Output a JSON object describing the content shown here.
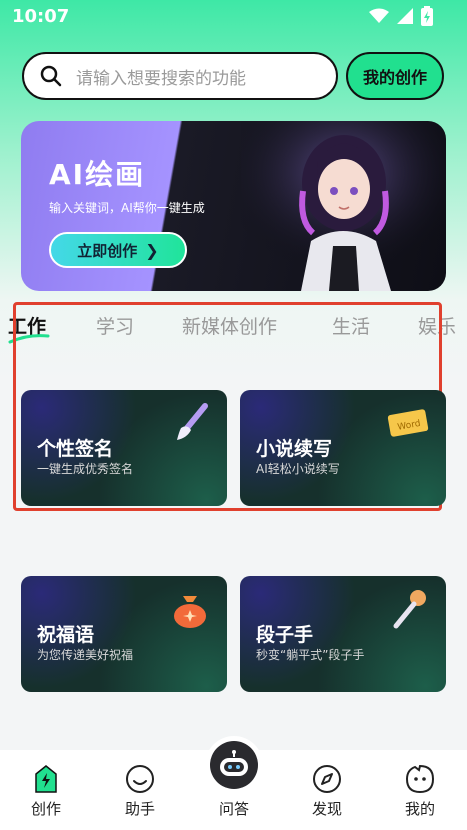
{
  "status": {
    "time": "10:07"
  },
  "search": {
    "placeholder": "请输入想要搜索的功能"
  },
  "header": {
    "my_create": "我的创作"
  },
  "banner": {
    "title": "AI绘画",
    "subtitle": "输入关键词，AI帮你一键生成",
    "cta": "立即创作"
  },
  "tabs": [
    {
      "label": "工作",
      "active": true
    },
    {
      "label": "学习"
    },
    {
      "label": "新媒体创作"
    },
    {
      "label": "生活"
    },
    {
      "label": "娱乐"
    }
  ],
  "cards": [
    {
      "title": "个性签名",
      "subtitle": "一键生成优秀签名",
      "icon": "brush-icon"
    },
    {
      "title": "小说续写",
      "subtitle": "AI轻松小说续写",
      "icon": "notebook-icon",
      "icon_text": "Word"
    },
    {
      "title": "祝福语",
      "subtitle": "为您传递美好祝福",
      "icon": "money-bag-icon"
    },
    {
      "title": "段子手",
      "subtitle": "秒变“躺平式”段子手",
      "icon": "microphone-icon"
    }
  ],
  "nav": [
    {
      "label": "创作",
      "icon": "create-icon"
    },
    {
      "label": "助手",
      "icon": "smile-icon"
    },
    {
      "label": "问答",
      "icon": "robot-icon"
    },
    {
      "label": "发现",
      "icon": "compass-icon"
    },
    {
      "label": "我的",
      "icon": "profile-icon"
    }
  ],
  "colors": {
    "accent": "#21e08f",
    "highlight_box": "#e0402e"
  }
}
